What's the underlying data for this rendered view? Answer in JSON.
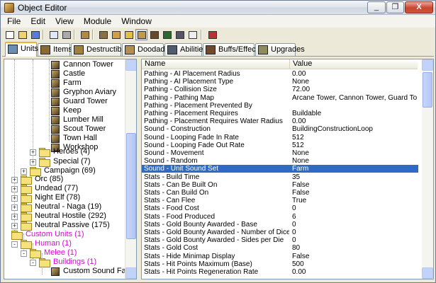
{
  "window": {
    "title": "Object Editor",
    "min": "_",
    "max": "❐",
    "close": "X"
  },
  "menu": [
    "File",
    "Edit",
    "View",
    "Module",
    "Window"
  ],
  "tabs": [
    {
      "label": "Units",
      "icon": "units-icon"
    },
    {
      "label": "Items",
      "icon": "items-icon"
    },
    {
      "label": "Destructibles",
      "icon": "destructibles-icon"
    },
    {
      "label": "Doodads",
      "icon": "doodads-icon"
    },
    {
      "label": "Abilities",
      "icon": "abilities-icon"
    },
    {
      "label": "Buffs/Effects",
      "icon": "buffs-icon"
    },
    {
      "label": "Upgrades",
      "icon": "upgrades-icon"
    }
  ],
  "tree": [
    {
      "label": "Cannon Tower",
      "kind": "unit"
    },
    {
      "label": "Castle",
      "kind": "unit"
    },
    {
      "label": "Farm",
      "kind": "unit"
    },
    {
      "label": "Gryphon Aviary",
      "kind": "unit"
    },
    {
      "label": "Guard Tower",
      "kind": "unit"
    },
    {
      "label": "Keep",
      "kind": "unit"
    },
    {
      "label": "Lumber Mill",
      "kind": "unit"
    },
    {
      "label": "Scout Tower",
      "kind": "unit"
    },
    {
      "label": "Town Hall",
      "kind": "unit"
    },
    {
      "label": "Workshop",
      "kind": "unit"
    },
    {
      "label": "Heroes (4)",
      "kind": "folder",
      "expander": "+"
    },
    {
      "label": "Special (7)",
      "kind": "folder",
      "expander": "+"
    },
    {
      "label": "Campaign (69)",
      "kind": "folder",
      "expander": "+"
    },
    {
      "label": "Orc (85)",
      "kind": "folder",
      "expander": "+"
    },
    {
      "label": "Undead (77)",
      "kind": "folder",
      "expander": "+"
    },
    {
      "label": "Night Elf (78)",
      "kind": "folder",
      "expander": "+"
    },
    {
      "label": "Neutral - Naga (19)",
      "kind": "folder",
      "expander": "+"
    },
    {
      "label": "Neutral Hostile (292)",
      "kind": "folder",
      "expander": "+"
    },
    {
      "label": "Neutral Passive (175)",
      "kind": "folder",
      "expander": "+"
    },
    {
      "label": "Custom Units (1)",
      "kind": "folder",
      "expander": "-",
      "custom": true
    },
    {
      "label": "Human (1)",
      "kind": "folder",
      "expander": "-",
      "custom": true
    },
    {
      "label": "Melee (1)",
      "kind": "folder",
      "expander": "-",
      "custom": true
    },
    {
      "label": "Buildings (1)",
      "kind": "folder",
      "expander": "-",
      "custom": true
    },
    {
      "label": "Custom Sound Farm",
      "kind": "unit"
    }
  ],
  "table": {
    "headers": {
      "name": "Name",
      "value": "Value"
    },
    "rows": [
      {
        "name": "Pathing - AI Placement Radius",
        "value": "0.00"
      },
      {
        "name": "Pathing - AI Placement Type",
        "value": "None"
      },
      {
        "name": "Pathing - Collision Size",
        "value": "72.00"
      },
      {
        "name": "Pathing - Pathing Map",
        "value": "Arcane Tower, Cannon Tower, Guard Tower, ..."
      },
      {
        "name": "Pathing - Placement Prevented By",
        "value": ""
      },
      {
        "name": "Pathing - Placement Requires",
        "value": "Buildable"
      },
      {
        "name": "Pathing - Placement Requires Water Radius",
        "value": "0.00"
      },
      {
        "name": "Sound - Construction",
        "value": "BuildingConstructionLoop"
      },
      {
        "name": "Sound - Looping Fade In Rate",
        "value": "512"
      },
      {
        "name": "Sound - Looping Fade Out Rate",
        "value": "512"
      },
      {
        "name": "Sound - Movement",
        "value": "None"
      },
      {
        "name": "Sound - Random",
        "value": "None"
      },
      {
        "name": "Sound - Unit Sound Set",
        "value": "Farm",
        "selected": true
      },
      {
        "name": "Stats - Build Time",
        "value": "35"
      },
      {
        "name": "Stats - Can Be Built On",
        "value": "False"
      },
      {
        "name": "Stats - Can Build On",
        "value": "False"
      },
      {
        "name": "Stats - Can Flee",
        "value": "True"
      },
      {
        "name": "Stats - Food Cost",
        "value": "0"
      },
      {
        "name": "Stats - Food Produced",
        "value": "6"
      },
      {
        "name": "Stats - Gold Bounty Awarded - Base",
        "value": "0"
      },
      {
        "name": "Stats - Gold Bounty Awarded - Number of Dice",
        "value": "0"
      },
      {
        "name": "Stats - Gold Bounty Awarded - Sides per Die",
        "value": "0"
      },
      {
        "name": "Stats - Gold Cost",
        "value": "80"
      },
      {
        "name": "Stats - Hide Minimap Display",
        "value": "False"
      },
      {
        "name": "Stats - Hit Points Maximum (Base)",
        "value": "500"
      },
      {
        "name": "Stats - Hit Points Regeneration Rate",
        "value": "0.00"
      }
    ]
  }
}
